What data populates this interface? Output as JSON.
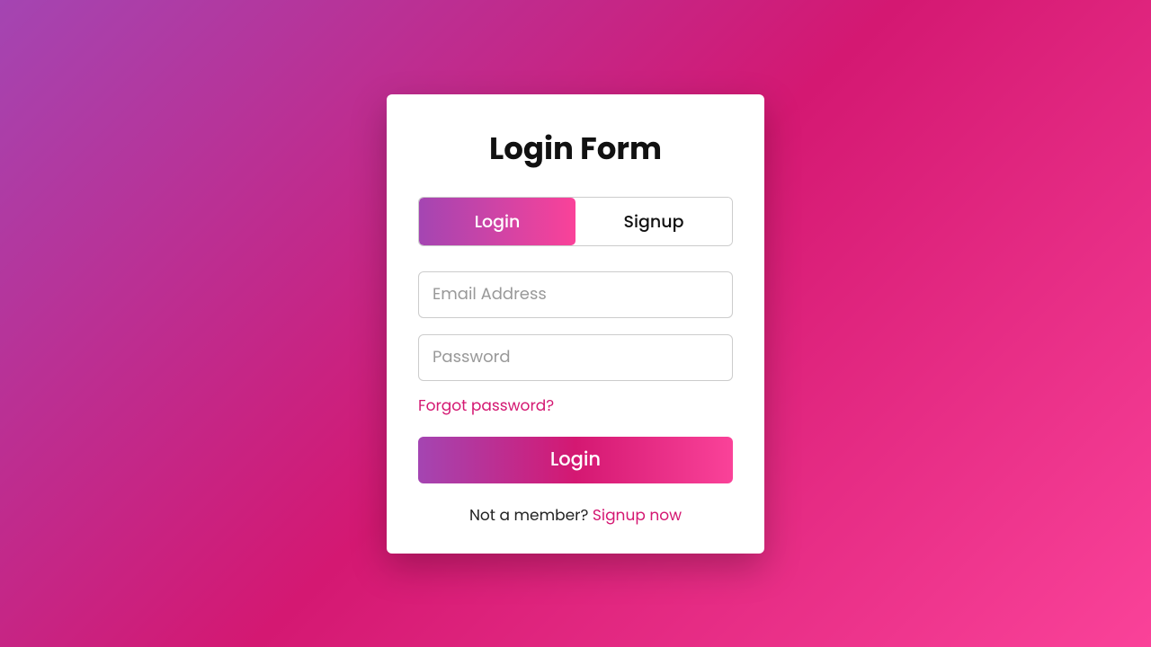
{
  "title": "Login Form",
  "tabs": {
    "login": "Login",
    "signup": "Signup"
  },
  "fields": {
    "email_placeholder": "Email Address",
    "password_placeholder": "Password"
  },
  "links": {
    "forgot": "Forgot password?",
    "signup_prompt": "Not a member? ",
    "signup_link": "Signup now"
  },
  "buttons": {
    "submit": "Login"
  },
  "colors": {
    "gradient_start": "#a445b2",
    "gradient_mid": "#d41872",
    "gradient_end": "#fa4299"
  }
}
